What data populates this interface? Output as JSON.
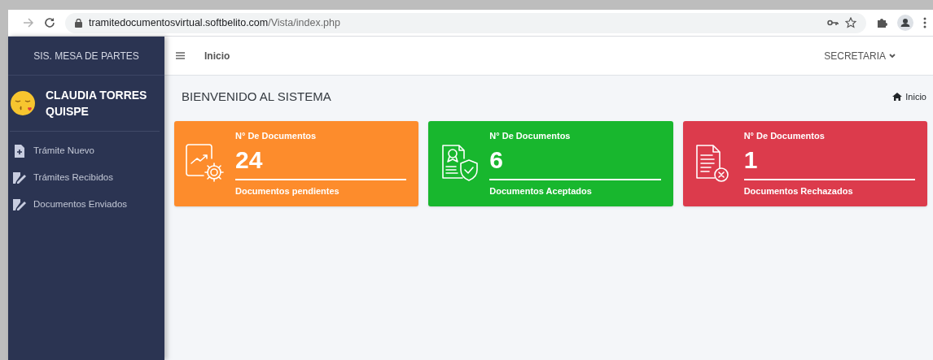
{
  "browser": {
    "url_host": "tramitedocumentosvirtual.softbelito.com",
    "url_path": "/Vista/index.php"
  },
  "sidebar": {
    "brand": "SIS. MESA DE PARTES",
    "user": "CLAUDIA TORRES QUISPE",
    "items": [
      {
        "label": "Trámite Nuevo",
        "kind": "new"
      },
      {
        "label": "Trámites Recibidos",
        "kind": "edit"
      },
      {
        "label": "Documentos Enviados",
        "kind": "edit"
      }
    ]
  },
  "topbar": {
    "link": "Inicio",
    "role": "SECRETARIA"
  },
  "page": {
    "title": "BIENVENIDO AL SISTEMA",
    "breadcrumb": "Inicio"
  },
  "cards": [
    {
      "kind": "pending",
      "color": "#fd8c2c",
      "heading": "N° De Documentos",
      "count": "24",
      "caption": "Documentos pendientes"
    },
    {
      "kind": "accepted",
      "color": "#18b72e",
      "heading": "N° De Documentos",
      "count": "6",
      "caption": "Documentos Aceptados"
    },
    {
      "kind": "rejected",
      "color": "#dc3b4c",
      "heading": "N° De Documentos",
      "count": "1",
      "caption": "Documentos Rechazados"
    }
  ]
}
